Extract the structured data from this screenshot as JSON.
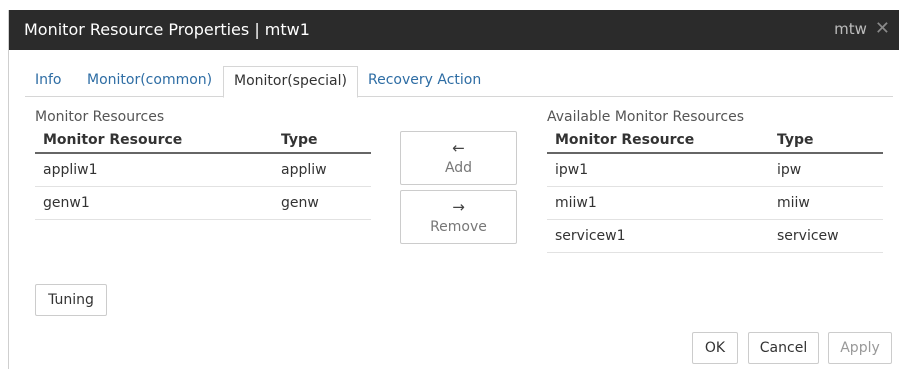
{
  "dialog": {
    "title": "Monitor Resource Properties | mtw1",
    "cluster_label": "mtw",
    "close_glyph": "✕"
  },
  "tabs": [
    {
      "label": "Info"
    },
    {
      "label": "Monitor(common)"
    },
    {
      "label": "Monitor(special)"
    },
    {
      "label": "Recovery Action"
    }
  ],
  "monitor_resources": {
    "heading": "Monitor Resources",
    "columns": [
      "Monitor Resource",
      "Type"
    ],
    "rows": [
      {
        "name": "appliw1",
        "type": "appliw"
      },
      {
        "name": "genw1",
        "type": "genw"
      }
    ]
  },
  "available_resources": {
    "heading": "Available Monitor Resources",
    "columns": [
      "Monitor Resource",
      "Type"
    ],
    "rows": [
      {
        "name": "ipw1",
        "type": "ipw"
      },
      {
        "name": "miiw1",
        "type": "miiw"
      },
      {
        "name": "servicew1",
        "type": "servicew"
      }
    ]
  },
  "move_buttons": {
    "add": {
      "arrow": "←",
      "label": "Add"
    },
    "remove": {
      "arrow": "→",
      "label": "Remove"
    }
  },
  "buttons": {
    "tuning": "Tuning",
    "ok": "OK",
    "cancel": "Cancel",
    "apply": "Apply"
  },
  "colors": {
    "titlebar": "#2b2b2b",
    "tab_link": "#2e6da4"
  }
}
